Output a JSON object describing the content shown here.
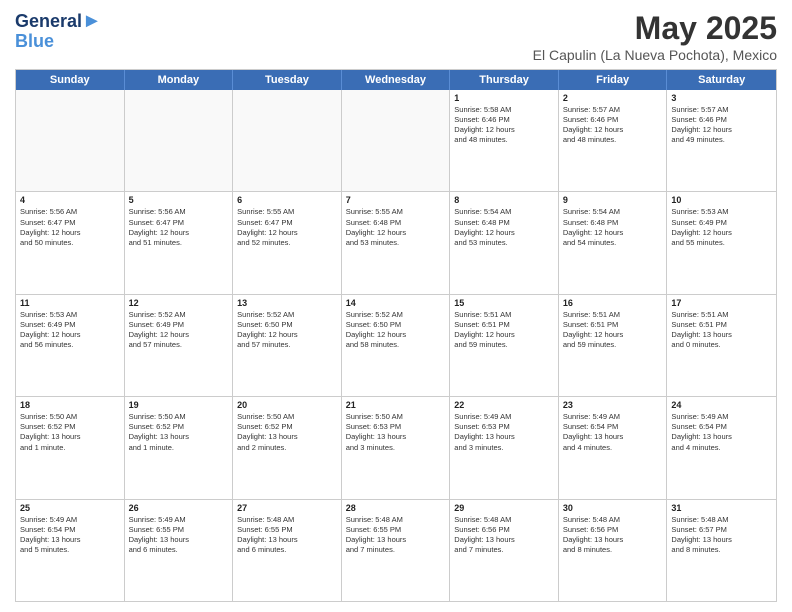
{
  "logo": {
    "line1": "General",
    "line2": "Blue"
  },
  "title": "May 2025",
  "subtitle": "El Capulin (La Nueva Pochota), Mexico",
  "days": [
    "Sunday",
    "Monday",
    "Tuesday",
    "Wednesday",
    "Thursday",
    "Friday",
    "Saturday"
  ],
  "rows": [
    [
      {
        "day": "",
        "text": "",
        "empty": true
      },
      {
        "day": "",
        "text": "",
        "empty": true
      },
      {
        "day": "",
        "text": "",
        "empty": true
      },
      {
        "day": "",
        "text": "",
        "empty": true
      },
      {
        "day": "1",
        "text": "Sunrise: 5:58 AM\nSunset: 6:46 PM\nDaylight: 12 hours\nand 48 minutes."
      },
      {
        "day": "2",
        "text": "Sunrise: 5:57 AM\nSunset: 6:46 PM\nDaylight: 12 hours\nand 48 minutes."
      },
      {
        "day": "3",
        "text": "Sunrise: 5:57 AM\nSunset: 6:46 PM\nDaylight: 12 hours\nand 49 minutes."
      }
    ],
    [
      {
        "day": "4",
        "text": "Sunrise: 5:56 AM\nSunset: 6:47 PM\nDaylight: 12 hours\nand 50 minutes."
      },
      {
        "day": "5",
        "text": "Sunrise: 5:56 AM\nSunset: 6:47 PM\nDaylight: 12 hours\nand 51 minutes."
      },
      {
        "day": "6",
        "text": "Sunrise: 5:55 AM\nSunset: 6:47 PM\nDaylight: 12 hours\nand 52 minutes."
      },
      {
        "day": "7",
        "text": "Sunrise: 5:55 AM\nSunset: 6:48 PM\nDaylight: 12 hours\nand 53 minutes."
      },
      {
        "day": "8",
        "text": "Sunrise: 5:54 AM\nSunset: 6:48 PM\nDaylight: 12 hours\nand 53 minutes."
      },
      {
        "day": "9",
        "text": "Sunrise: 5:54 AM\nSunset: 6:48 PM\nDaylight: 12 hours\nand 54 minutes."
      },
      {
        "day": "10",
        "text": "Sunrise: 5:53 AM\nSunset: 6:49 PM\nDaylight: 12 hours\nand 55 minutes."
      }
    ],
    [
      {
        "day": "11",
        "text": "Sunrise: 5:53 AM\nSunset: 6:49 PM\nDaylight: 12 hours\nand 56 minutes."
      },
      {
        "day": "12",
        "text": "Sunrise: 5:52 AM\nSunset: 6:49 PM\nDaylight: 12 hours\nand 57 minutes."
      },
      {
        "day": "13",
        "text": "Sunrise: 5:52 AM\nSunset: 6:50 PM\nDaylight: 12 hours\nand 57 minutes."
      },
      {
        "day": "14",
        "text": "Sunrise: 5:52 AM\nSunset: 6:50 PM\nDaylight: 12 hours\nand 58 minutes."
      },
      {
        "day": "15",
        "text": "Sunrise: 5:51 AM\nSunset: 6:51 PM\nDaylight: 12 hours\nand 59 minutes."
      },
      {
        "day": "16",
        "text": "Sunrise: 5:51 AM\nSunset: 6:51 PM\nDaylight: 12 hours\nand 59 minutes."
      },
      {
        "day": "17",
        "text": "Sunrise: 5:51 AM\nSunset: 6:51 PM\nDaylight: 13 hours\nand 0 minutes."
      }
    ],
    [
      {
        "day": "18",
        "text": "Sunrise: 5:50 AM\nSunset: 6:52 PM\nDaylight: 13 hours\nand 1 minute."
      },
      {
        "day": "19",
        "text": "Sunrise: 5:50 AM\nSunset: 6:52 PM\nDaylight: 13 hours\nand 1 minute."
      },
      {
        "day": "20",
        "text": "Sunrise: 5:50 AM\nSunset: 6:52 PM\nDaylight: 13 hours\nand 2 minutes."
      },
      {
        "day": "21",
        "text": "Sunrise: 5:50 AM\nSunset: 6:53 PM\nDaylight: 13 hours\nand 3 minutes."
      },
      {
        "day": "22",
        "text": "Sunrise: 5:49 AM\nSunset: 6:53 PM\nDaylight: 13 hours\nand 3 minutes."
      },
      {
        "day": "23",
        "text": "Sunrise: 5:49 AM\nSunset: 6:54 PM\nDaylight: 13 hours\nand 4 minutes."
      },
      {
        "day": "24",
        "text": "Sunrise: 5:49 AM\nSunset: 6:54 PM\nDaylight: 13 hours\nand 4 minutes."
      }
    ],
    [
      {
        "day": "25",
        "text": "Sunrise: 5:49 AM\nSunset: 6:54 PM\nDaylight: 13 hours\nand 5 minutes."
      },
      {
        "day": "26",
        "text": "Sunrise: 5:49 AM\nSunset: 6:55 PM\nDaylight: 13 hours\nand 6 minutes."
      },
      {
        "day": "27",
        "text": "Sunrise: 5:48 AM\nSunset: 6:55 PM\nDaylight: 13 hours\nand 6 minutes."
      },
      {
        "day": "28",
        "text": "Sunrise: 5:48 AM\nSunset: 6:55 PM\nDaylight: 13 hours\nand 7 minutes."
      },
      {
        "day": "29",
        "text": "Sunrise: 5:48 AM\nSunset: 6:56 PM\nDaylight: 13 hours\nand 7 minutes."
      },
      {
        "day": "30",
        "text": "Sunrise: 5:48 AM\nSunset: 6:56 PM\nDaylight: 13 hours\nand 8 minutes."
      },
      {
        "day": "31",
        "text": "Sunrise: 5:48 AM\nSunset: 6:57 PM\nDaylight: 13 hours\nand 8 minutes."
      }
    ]
  ]
}
